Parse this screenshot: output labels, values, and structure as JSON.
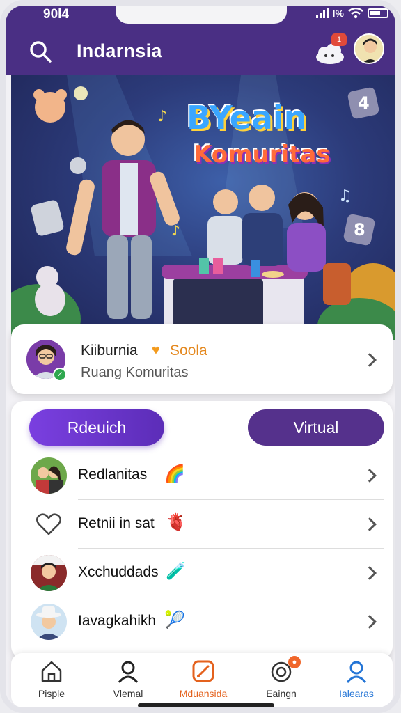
{
  "status": {
    "time": "90l4",
    "percent": "l%"
  },
  "header": {
    "title": "Indarnsia",
    "notif_count": "1"
  },
  "hero": {
    "title_line1": "BYeain",
    "title_line2": "Komuritas",
    "tile_top": "4",
    "tile_bottom": "8"
  },
  "profile": {
    "name": "Kiiburnia",
    "role": "Soola",
    "subtitle": "Ruang Komuritas"
  },
  "tabs": {
    "left": "Rdeuich",
    "right": "Virtual"
  },
  "list": [
    {
      "label": "Redlanitas",
      "icon": "avatar-couple-icon",
      "emoji": "🌈"
    },
    {
      "label": "Retnii in sat",
      "icon": "heart-outline-icon",
      "emoji": "🫀"
    },
    {
      "label": "Xcchuddads",
      "icon": "avatar-man-icon",
      "emoji": "🧪"
    },
    {
      "label": "Iavagkahikh",
      "icon": "avatar-hat-icon",
      "emoji": "🎾"
    }
  ],
  "nav": [
    {
      "label": "Pisple",
      "icon": "home-icon",
      "color": "#333333"
    },
    {
      "label": "Vlemal",
      "icon": "person-icon",
      "color": "#333333"
    },
    {
      "label": "Mduansida",
      "icon": "edit-square-icon",
      "color": "#e4621e"
    },
    {
      "label": "Eaingn",
      "icon": "clock-badge-icon",
      "color": "#333333",
      "badge": "●"
    },
    {
      "label": "Ialearas",
      "icon": "person-blue-icon",
      "color": "#2475d6"
    }
  ],
  "colors": {
    "header": "#4a2f84",
    "accent": "#7a3fe0",
    "orange": "#e4881e"
  }
}
